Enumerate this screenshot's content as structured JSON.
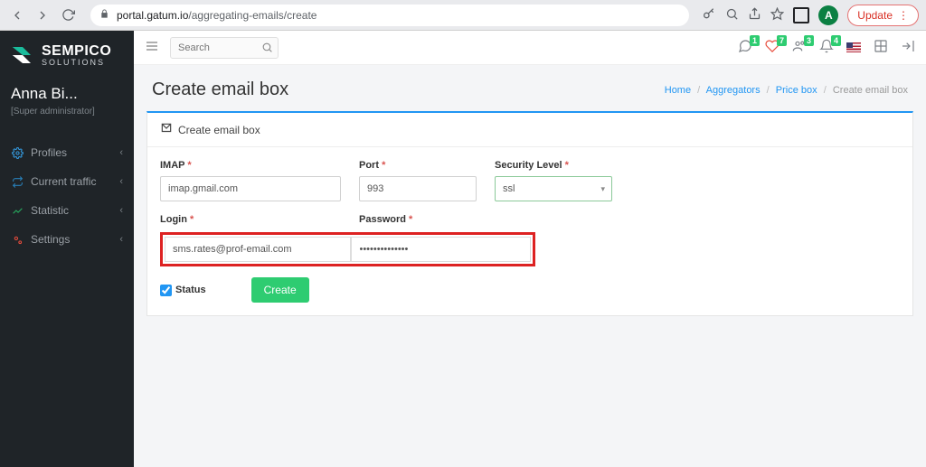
{
  "browser": {
    "url_prefix": "portal.gatum.io",
    "url_path": "/aggregating-emails/create",
    "update_label": "Update",
    "avatar_letter": "A"
  },
  "sidebar": {
    "brand": "SEMPICO",
    "brand_sub": "SOLUTIONS",
    "user_name": "Anna Bi...",
    "user_role": "[Super administrator]",
    "items": [
      {
        "label": "Profiles",
        "icon_color": "#3498db"
      },
      {
        "label": "Current traffic",
        "icon_color": "#2980b9"
      },
      {
        "label": "Statistic",
        "icon_color": "#27ae60"
      },
      {
        "label": "Settings",
        "icon_color": "#e74c3c"
      }
    ]
  },
  "topbar": {
    "search_placeholder": "Search",
    "notif_badges": [
      "1",
      "7",
      "3",
      "4"
    ]
  },
  "page": {
    "title": "Create email box",
    "breadcrumb": {
      "home": "Home",
      "aggregators": "Aggregators",
      "pricebox": "Price box",
      "current": "Create email box"
    },
    "card_title": "Create email box"
  },
  "form": {
    "imap_label": "IMAP",
    "imap_value": "imap.gmail.com",
    "port_label": "Port",
    "port_value": "993",
    "security_label": "Security Level",
    "security_value": "ssl",
    "login_label": "Login",
    "login_value": "sms.rates@prof-email.com",
    "password_label": "Password",
    "password_value": "••••••••••••••",
    "status_label": "Status",
    "create_label": "Create"
  }
}
